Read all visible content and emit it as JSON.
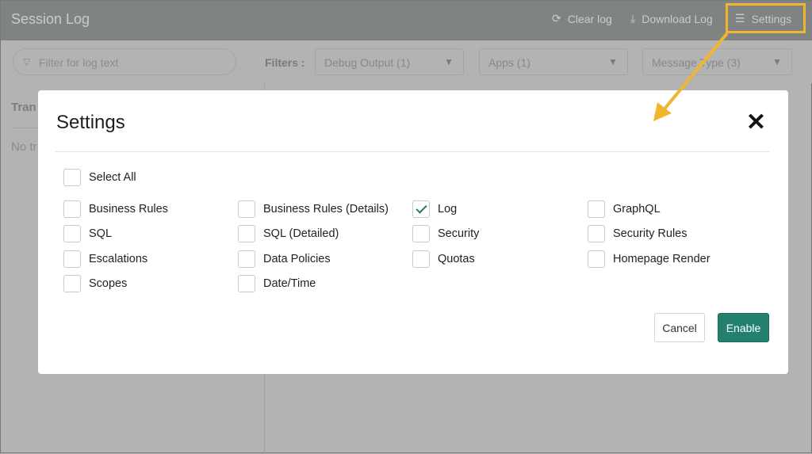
{
  "header": {
    "title": "Session Log",
    "clear_log": "Clear log",
    "download_log": "Download Log",
    "settings": "Settings"
  },
  "filters": {
    "search_placeholder": "Filter for log text",
    "label": "Filters :",
    "debug_output": "Debug Output (1)",
    "apps": "Apps (1)",
    "message_type": "Message Type (3)"
  },
  "left_panel": {
    "heading": "Tran",
    "empty": "No tr"
  },
  "modal": {
    "title": "Settings",
    "select_all": "Select All",
    "options": [
      {
        "label": "Business Rules",
        "checked": false
      },
      {
        "label": "Business Rules (Details)",
        "checked": false
      },
      {
        "label": "Log",
        "checked": true
      },
      {
        "label": "GraphQL",
        "checked": false
      },
      {
        "label": "SQL",
        "checked": false
      },
      {
        "label": "SQL (Detailed)",
        "checked": false
      },
      {
        "label": "Security",
        "checked": false
      },
      {
        "label": "Security Rules",
        "checked": false
      },
      {
        "label": "Escalations",
        "checked": false
      },
      {
        "label": "Data Policies",
        "checked": false
      },
      {
        "label": "Quotas",
        "checked": false
      },
      {
        "label": "Homepage Render",
        "checked": false
      },
      {
        "label": "Scopes",
        "checked": false
      },
      {
        "label": "Date/Time",
        "checked": false
      }
    ],
    "cancel": "Cancel",
    "enable": "Enable"
  },
  "colors": {
    "accent": "#23806f",
    "annotation": "#f2b530"
  }
}
